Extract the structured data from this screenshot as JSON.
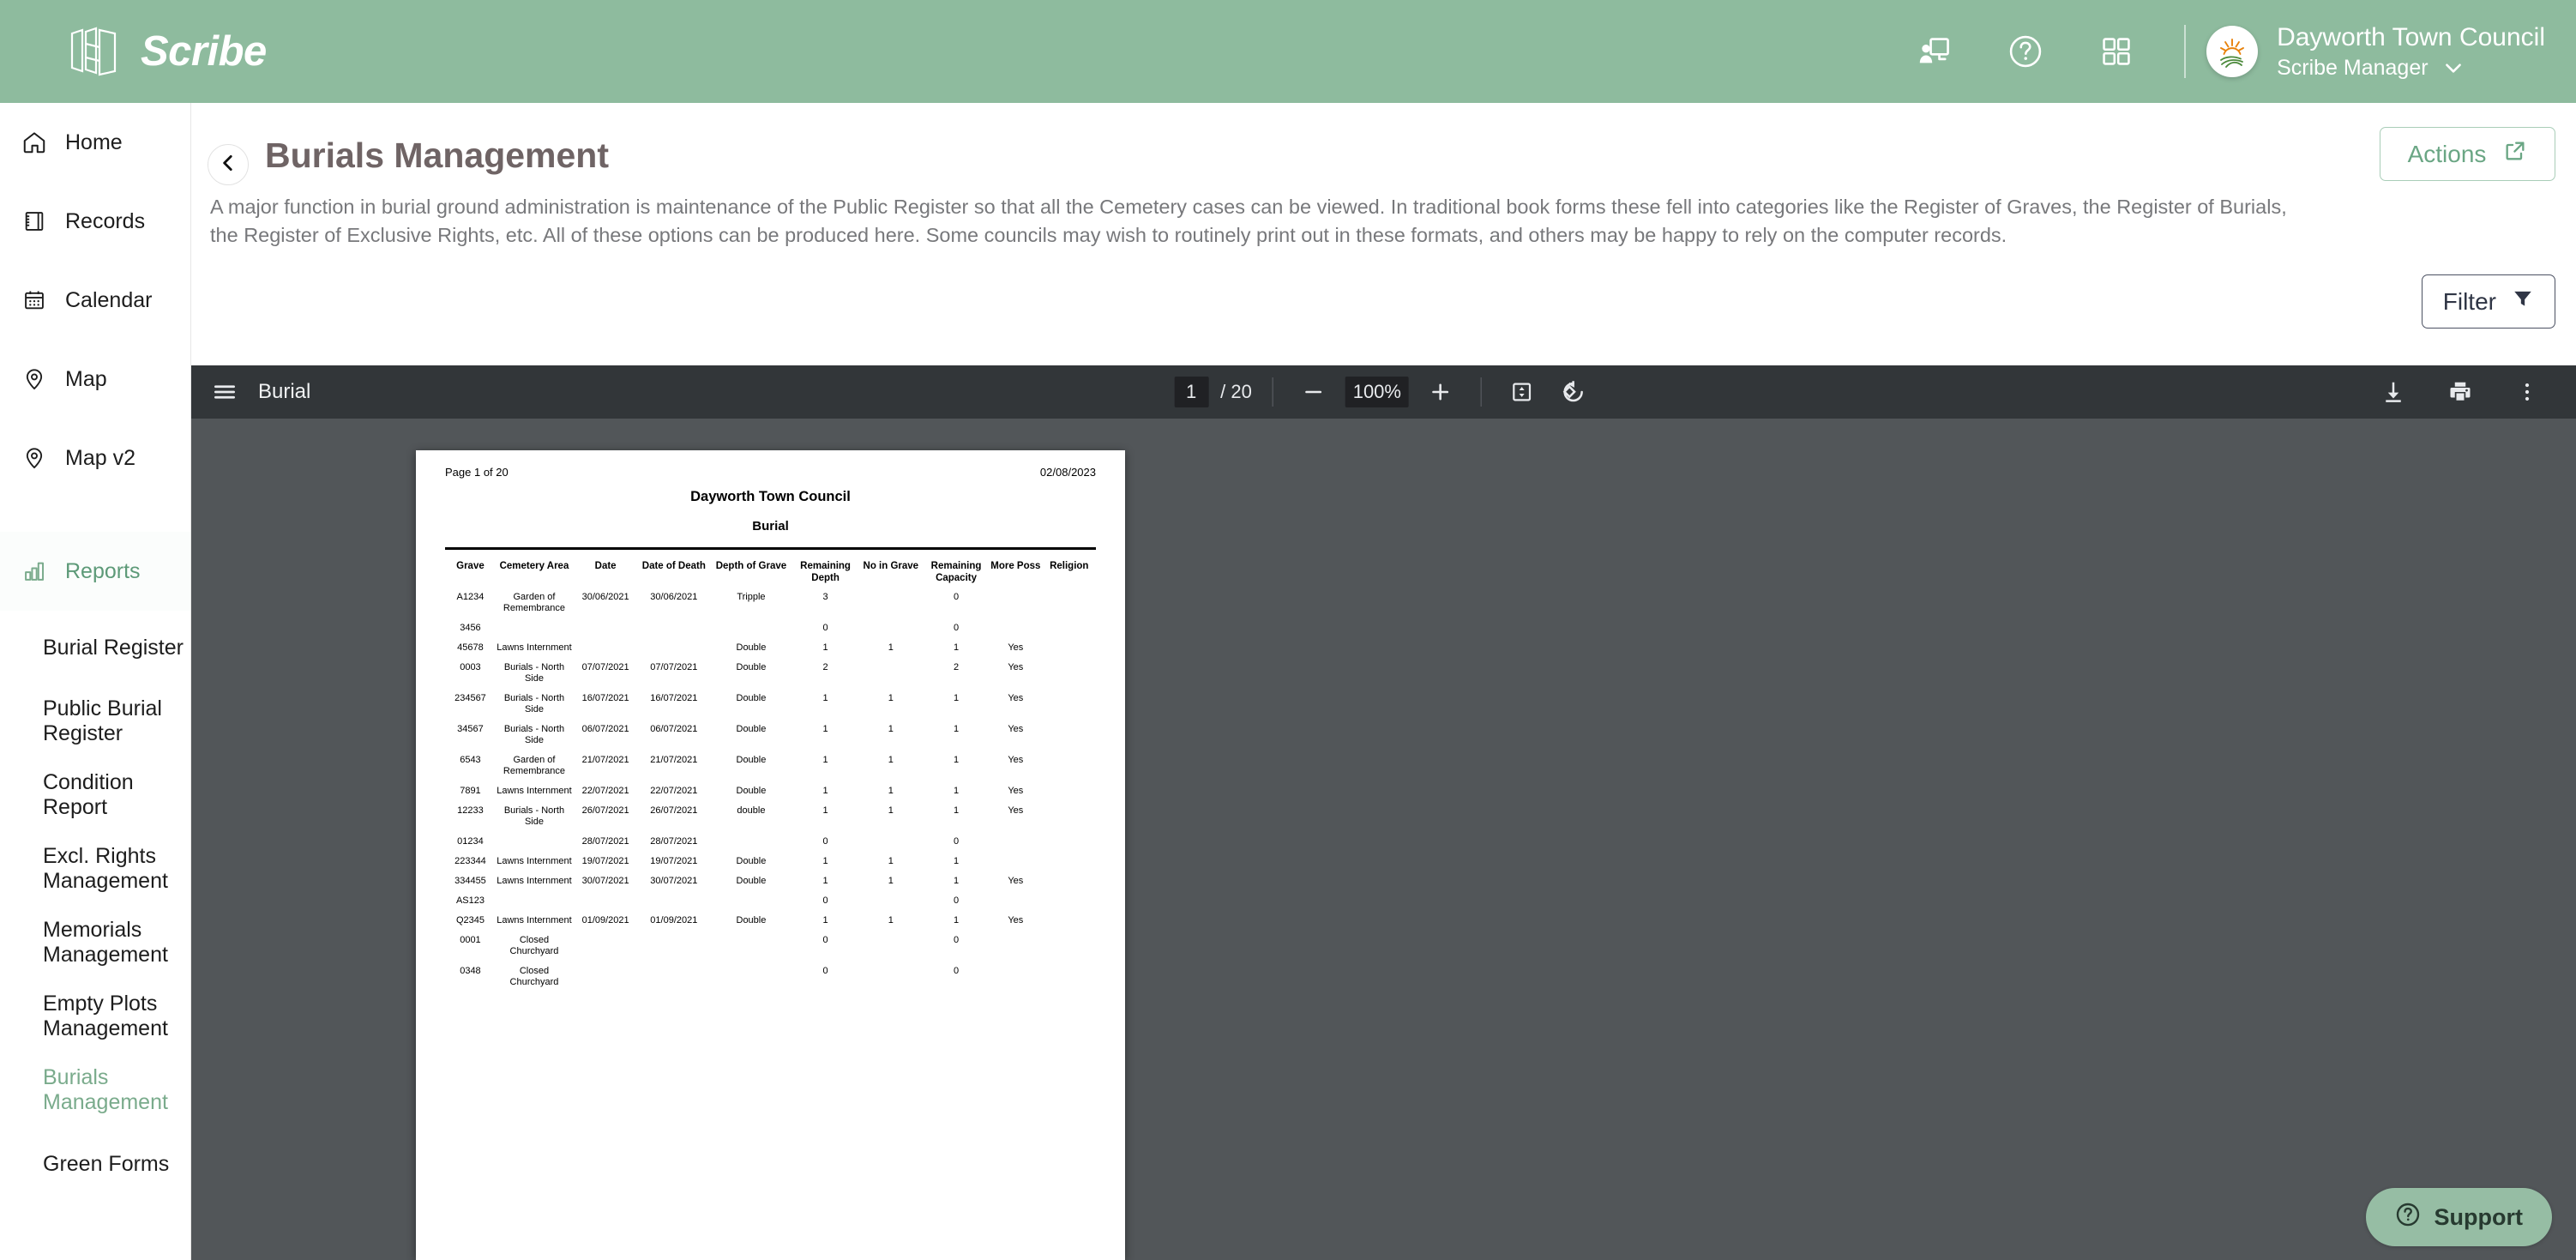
{
  "brand": {
    "name": "Scribe",
    "logo_icon": "book-logo-icon"
  },
  "topbar": {
    "icons": [
      {
        "name": "presentation-user-icon"
      },
      {
        "name": "help-circle-icon"
      },
      {
        "name": "apps-grid-icon"
      }
    ],
    "user": {
      "avatar_icon": "sunrise-avatar-icon",
      "name": "Dayworth Town Council",
      "role": "Scribe Manager",
      "caret_icon": "chevron-down-icon"
    }
  },
  "sidebar": {
    "items": [
      {
        "label": "Home",
        "icon": "home-icon",
        "active": false
      },
      {
        "label": "Records",
        "icon": "book-icon",
        "active": false
      },
      {
        "label": "Calendar",
        "icon": "calendar-icon",
        "active": false
      },
      {
        "label": "Map",
        "icon": "map-pin-icon",
        "active": false
      },
      {
        "label": "Map v2",
        "icon": "map-pin-icon",
        "active": false
      },
      {
        "label": "Reports",
        "icon": "bar-chart-icon",
        "active": true
      }
    ],
    "sub_items": [
      {
        "label": "Burial Register",
        "selected": false
      },
      {
        "label": "Public Burial Register",
        "selected": false
      },
      {
        "label": "Condition Report",
        "selected": false
      },
      {
        "label": "Excl. Rights Management",
        "selected": false
      },
      {
        "label": "Memorials Management",
        "selected": false
      },
      {
        "label": "Empty Plots Management",
        "selected": false
      },
      {
        "label": "Burials Management",
        "selected": true
      },
      {
        "label": "Green Forms",
        "selected": false
      }
    ]
  },
  "page": {
    "back_icon": "chevron-left-icon",
    "title": "Burials Management",
    "description": "A major function in burial ground administration is maintenance of the Public Register so that all the Cemetery cases can be viewed. In traditional book forms these fell into categories like the Register of Graves, the Register of Burials, the Register of Exclusive Rights, etc. All of these options can be produced here. Some councils may wish to routinely print out in these formats, and others may be happy to rely on the computer records.",
    "actions_label": "Actions",
    "actions_icon": "external-link-icon",
    "filter_label": "Filter",
    "filter_icon": "funnel-icon"
  },
  "pdf_toolbar": {
    "menu_icon": "hamburger-menu-icon",
    "doc_title": "Burial",
    "current_page": "1",
    "page_separator": "/ 20",
    "zoom_out_icon": "minus-icon",
    "zoom_level": "100%",
    "zoom_in_icon": "plus-icon",
    "fit_page_icon": "fit-to-page-icon",
    "rotate_icon": "rotate-counterclockwise-icon",
    "download_icon": "download-icon",
    "print_icon": "print-icon",
    "more_icon": "more-vertical-icon"
  },
  "document": {
    "page_label": "Page 1 of 20",
    "date": "02/08/2023",
    "heading": "Dayworth Town Council",
    "subheading": "Burial",
    "columns": [
      "Grave",
      "Cemetery Area",
      "Date",
      "Date of Death",
      "Depth of Grave",
      "Remaining Depth",
      "No in Grave",
      "Remaining Capacity",
      "More Poss",
      "Religion"
    ],
    "column_lines": [
      [
        "Grave"
      ],
      [
        "Cemetery Area"
      ],
      [
        "Date"
      ],
      [
        "Date of Death"
      ],
      [
        "Depth of Grave"
      ],
      [
        "Remaining",
        "Depth"
      ],
      [
        "No in Grave"
      ],
      [
        "Remaining",
        "Capacity"
      ],
      [
        "More Poss"
      ],
      [
        "Religion"
      ]
    ],
    "rows": [
      {
        "grave": "A1234",
        "area": "Garden of Remembrance",
        "date": "30/06/2021",
        "dod": "30/06/2021",
        "depth": "Tripple",
        "rdepth": "3",
        "noin": "",
        "rcap": "0",
        "poss": "",
        "religion": ""
      },
      {
        "grave": "3456",
        "area": "",
        "date": "",
        "dod": "",
        "depth": "",
        "rdepth": "0",
        "noin": "",
        "rcap": "0",
        "poss": "",
        "religion": ""
      },
      {
        "grave": "45678",
        "area": "Lawns Internment",
        "date": "",
        "dod": "",
        "depth": "Double",
        "rdepth": "1",
        "noin": "1",
        "rcap": "1",
        "poss": "Yes",
        "religion": ""
      },
      {
        "grave": "0003",
        "area": "Burials - North Side",
        "date": "07/07/2021",
        "dod": "07/07/2021",
        "depth": "Double",
        "rdepth": "2",
        "noin": "",
        "rcap": "2",
        "poss": "Yes",
        "religion": ""
      },
      {
        "grave": "234567",
        "area": "Burials - North Side",
        "date": "16/07/2021",
        "dod": "16/07/2021",
        "depth": "Double",
        "rdepth": "1",
        "noin": "1",
        "rcap": "1",
        "poss": "Yes",
        "religion": ""
      },
      {
        "grave": "34567",
        "area": "Burials - North Side",
        "date": "06/07/2021",
        "dod": "06/07/2021",
        "depth": "Double",
        "rdepth": "1",
        "noin": "1",
        "rcap": "1",
        "poss": "Yes",
        "religion": ""
      },
      {
        "grave": "6543",
        "area": "Garden of Remembrance",
        "date": "21/07/2021",
        "dod": "21/07/2021",
        "depth": "Double",
        "rdepth": "1",
        "noin": "1",
        "rcap": "1",
        "poss": "Yes",
        "religion": ""
      },
      {
        "grave": "7891",
        "area": "Lawns Internment",
        "date": "22/07/2021",
        "dod": "22/07/2021",
        "depth": "Double",
        "rdepth": "1",
        "noin": "1",
        "rcap": "1",
        "poss": "Yes",
        "religion": ""
      },
      {
        "grave": "12233",
        "area": "Burials - North Side",
        "date": "26/07/2021",
        "dod": "26/07/2021",
        "depth": "double",
        "rdepth": "1",
        "noin": "1",
        "rcap": "1",
        "poss": "Yes",
        "religion": ""
      },
      {
        "grave": "01234",
        "area": "",
        "date": "28/07/2021",
        "dod": "28/07/2021",
        "depth": "",
        "rdepth": "0",
        "noin": "",
        "rcap": "0",
        "poss": "",
        "religion": ""
      },
      {
        "grave": "223344",
        "area": "Lawns Internment",
        "date": "19/07/2021",
        "dod": "19/07/2021",
        "depth": "Double",
        "rdepth": "1",
        "noin": "1",
        "rcap": "1",
        "poss": "",
        "religion": ""
      },
      {
        "grave": "334455",
        "area": "Lawns Internment",
        "date": "30/07/2021",
        "dod": "30/07/2021",
        "depth": "Double",
        "rdepth": "1",
        "noin": "1",
        "rcap": "1",
        "poss": "Yes",
        "religion": ""
      },
      {
        "grave": "AS123",
        "area": "",
        "date": "",
        "dod": "",
        "depth": "",
        "rdepth": "0",
        "noin": "",
        "rcap": "0",
        "poss": "",
        "religion": ""
      },
      {
        "grave": "Q2345",
        "area": "Lawns Internment",
        "date": "01/09/2021",
        "dod": "01/09/2021",
        "depth": "Double",
        "rdepth": "1",
        "noin": "1",
        "rcap": "1",
        "poss": "Yes",
        "religion": ""
      },
      {
        "grave": "0001",
        "area": "Closed Churchyard",
        "date": "",
        "dod": "",
        "depth": "",
        "rdepth": "0",
        "noin": "",
        "rcap": "0",
        "poss": "",
        "religion": ""
      },
      {
        "grave": "0348",
        "area": "Closed Churchyard",
        "date": "",
        "dod": "",
        "depth": "",
        "rdepth": "0",
        "noin": "",
        "rcap": "0",
        "poss": "",
        "religion": ""
      }
    ]
  },
  "support": {
    "label": "Support",
    "icon": "help-circle-icon"
  },
  "colors": {
    "brand_green": "#8ebb9e",
    "accent_green": "#5d9a78",
    "toolbar_dark": "#323639",
    "viewer_gray": "#525659",
    "title_gray": "#6f6465"
  }
}
